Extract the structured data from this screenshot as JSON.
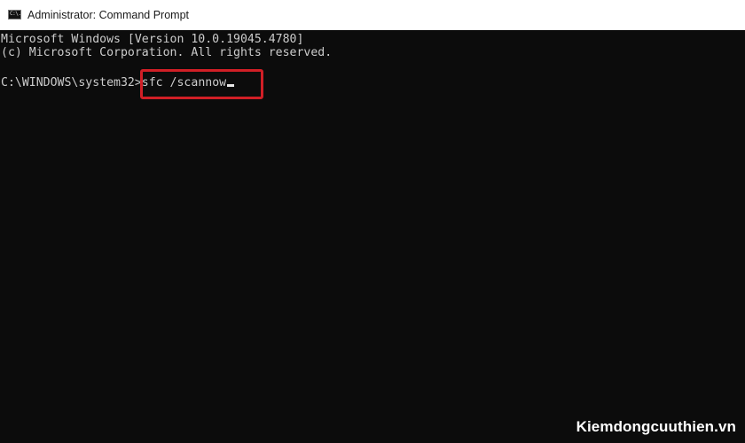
{
  "window": {
    "title": "Administrator: Command Prompt",
    "icon": "cmd-icon",
    "icon_glyph": "C:\\."
  },
  "console": {
    "lines": [
      "Microsoft Windows [Version 10.0.19045.4780]",
      "(c) Microsoft Corporation. All rights reserved."
    ],
    "prompt": "C:\\WINDOWS\\system32>",
    "command": "sfc /scannow",
    "background_color": "#0c0c0c",
    "text_color": "#cccccc",
    "highlight_color": "#d11f26"
  },
  "watermark": {
    "text": "Kiemdongcuuthien.vn"
  }
}
